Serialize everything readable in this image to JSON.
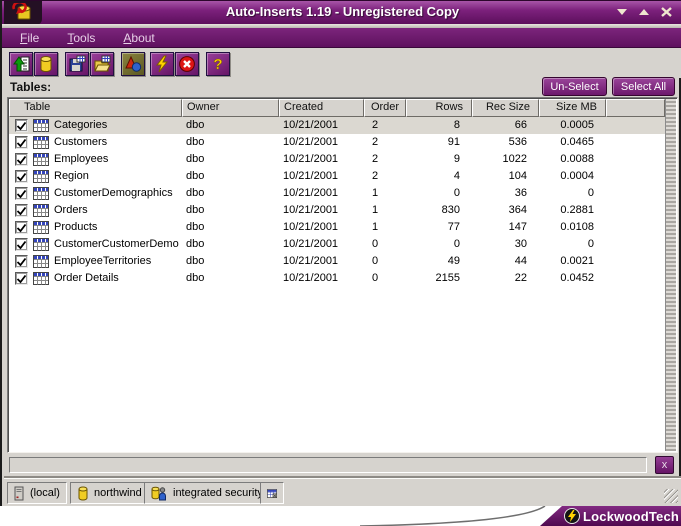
{
  "window": {
    "title": "Auto-Inserts 1.19 - Unregistered Copy",
    "controls": [
      "minimize",
      "maximize",
      "close"
    ]
  },
  "menu": {
    "items": [
      {
        "accel": "F",
        "rest": "ile"
      },
      {
        "accel": "T",
        "rest": "ools"
      },
      {
        "accel": "A",
        "rest": "bout"
      }
    ]
  },
  "toolbar": {
    "icons": [
      "import-table-icon",
      "database-drum-icon",
      "save-script-icon",
      "open-script-icon",
      "objects-icon",
      "execute-lightning-icon",
      "cancel-icon",
      "help-icon"
    ]
  },
  "panel": {
    "tables_label": "Tables:",
    "unselect_button": "Un-Select",
    "select_all_button": "Select All"
  },
  "table": {
    "columns": [
      "Table",
      "Owner",
      "Created",
      "Order",
      "Rows",
      "Rec Size",
      "Size MB"
    ],
    "rows": [
      {
        "name": "Categories",
        "owner": "dbo",
        "created": "10/21/2001",
        "order": "2",
        "rows": "8",
        "rec_size": "66",
        "size_mb": "0.0005",
        "checked": true,
        "selected": true
      },
      {
        "name": "Customers",
        "owner": "dbo",
        "created": "10/21/2001",
        "order": "2",
        "rows": "91",
        "rec_size": "536",
        "size_mb": "0.0465",
        "checked": true,
        "selected": false
      },
      {
        "name": "Employees",
        "owner": "dbo",
        "created": "10/21/2001",
        "order": "2",
        "rows": "9",
        "rec_size": "1022",
        "size_mb": "0.0088",
        "checked": true,
        "selected": false
      },
      {
        "name": "Region",
        "owner": "dbo",
        "created": "10/21/2001",
        "order": "2",
        "rows": "4",
        "rec_size": "104",
        "size_mb": "0.0004",
        "checked": true,
        "selected": false
      },
      {
        "name": "CustomerDemographics",
        "owner": "dbo",
        "created": "10/21/2001",
        "order": "1",
        "rows": "0",
        "rec_size": "36",
        "size_mb": "0",
        "checked": true,
        "selected": false
      },
      {
        "name": "Orders",
        "owner": "dbo",
        "created": "10/21/2001",
        "order": "1",
        "rows": "830",
        "rec_size": "364",
        "size_mb": "0.2881",
        "checked": true,
        "selected": false
      },
      {
        "name": "Products",
        "owner": "dbo",
        "created": "10/21/2001",
        "order": "1",
        "rows": "77",
        "rec_size": "147",
        "size_mb": "0.0108",
        "checked": true,
        "selected": false
      },
      {
        "name": "CustomerCustomerDemo",
        "owner": "dbo",
        "created": "10/21/2001",
        "order": "0",
        "rows": "0",
        "rec_size": "30",
        "size_mb": "0",
        "checked": true,
        "selected": false
      },
      {
        "name": "EmployeeTerritories",
        "owner": "dbo",
        "created": "10/21/2001",
        "order": "0",
        "rows": "49",
        "rec_size": "44",
        "size_mb": "0.0021",
        "checked": true,
        "selected": false
      },
      {
        "name": "Order Details",
        "owner": "dbo",
        "created": "10/21/2001",
        "order": "0",
        "rows": "2155",
        "rec_size": "22",
        "size_mb": "0.0452",
        "checked": true,
        "selected": false
      }
    ]
  },
  "progress": {
    "close_button": "x"
  },
  "statusbar": {
    "server": "(local)",
    "database": "northwind",
    "security": "integrated security"
  },
  "branding": {
    "logo_text": "LockwoodTech"
  },
  "colors": {
    "titlebar_purple": "#7c217c",
    "menubar_purple": "#6a176a",
    "chrome_gray": "#d6d3ce",
    "selected_row": "#dbd8d1",
    "banner_purple": "#5c0f5c",
    "accent_yellow": "#ffd400"
  }
}
